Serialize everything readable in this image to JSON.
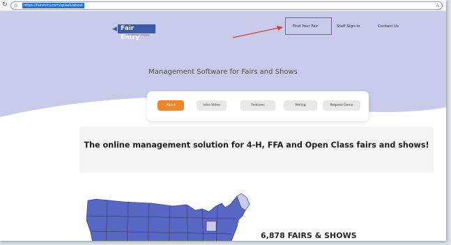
{
  "browser": {
    "url": "https://fairentry.com/splash/about"
  },
  "header": {
    "logo_text": "Fair Entry",
    "logo_subtext": "a Shelbiness company",
    "nav": [
      "Find Your Fair",
      "Staff Sign-in",
      "Contact Us"
    ]
  },
  "hero": {
    "tagline": "Management Software for Fairs and Shows",
    "tabs": [
      "About",
      "Intro Video",
      "Features",
      "Pricing",
      "Request Demo"
    ],
    "active_tab": "About"
  },
  "main": {
    "headline": "The online management solution for 4-H, FFA and Open Class fairs and shows!",
    "stat": "6,878 FAIRS & SHOWS"
  },
  "colors": {
    "hero_bg": "#c7cbe9",
    "accent": "#f0862c",
    "logo_blue": "#3c5aa8",
    "map_blue": "#5967c4",
    "annotation_red": "#e03c3c"
  },
  "icons": {
    "reload": "reload-icon",
    "lock": "lock-icon",
    "reader": "read-aloud-icon",
    "logo_arrow": "left-arrow-icon"
  }
}
